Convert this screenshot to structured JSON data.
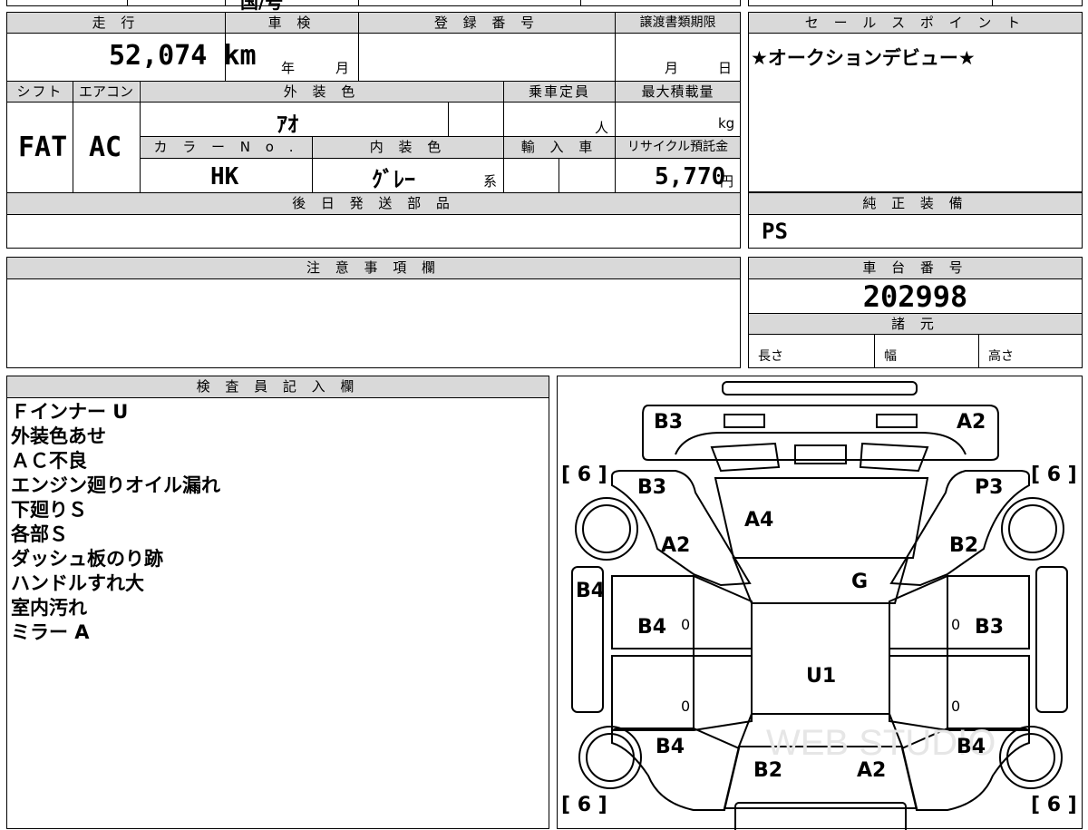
{
  "top_partial": {
    "fragment": "国/号"
  },
  "table": {
    "headers": {
      "mileage": "走 行",
      "inspection": "車 検",
      "registration": "登 録 番 号",
      "transfer_deadline": "譲渡書類期限",
      "shift": "シフト",
      "aircon": "エアコン",
      "exterior_color": "外 装 色",
      "capacity": "乗車定員",
      "max_load": "最大積載量",
      "color_no": "カ ラ ー N o .",
      "interior_color": "内 装 色",
      "import": "輸 入 車",
      "recycle_fee": "リサイクル預託金",
      "later_parts": "後 日 発 送 部 品"
    },
    "values": {
      "mileage": "52,074",
      "mileage_unit": "km",
      "year_unit": "年",
      "month_unit": "月",
      "month_unit2": "月",
      "day_unit": "日",
      "shift": "FAT",
      "aircon": "AC",
      "exterior_color": "ｱｵ",
      "capacity_unit": "人",
      "load_unit": "kg",
      "color_no": "HK",
      "interior_color": "ｸﾞﾚｰ",
      "interior_suffix": "系",
      "recycle_fee": "5,770",
      "recycle_unit": "円"
    }
  },
  "sales_point": {
    "header": "セ ー ル ス ポ イ ン ト",
    "text": "★オークションデビュー★"
  },
  "genuine_equipment": {
    "header": "純 正 装 備",
    "text": "PS"
  },
  "cautions": {
    "header": "注 意 事 項 欄"
  },
  "chassis": {
    "header": "車 台 番 号",
    "number": "202998"
  },
  "specs": {
    "header": "諸 元",
    "length": "長さ",
    "width": "幅",
    "height": "高さ"
  },
  "inspector_notes": {
    "header": "検 査 員 記 入 欄",
    "lines": [
      "Ｆインナー U",
      "外装色あせ",
      "ＡＣ不良",
      "エンジン廻りオイル漏れ",
      "下廻りＳ",
      "各部Ｓ",
      "ダッシュ板のり跡",
      "ハンドルすれ大",
      "室内汚れ",
      "ミラー A"
    ]
  },
  "diagram": {
    "labels": {
      "top_left": "B3",
      "top_right": "A2",
      "front_left_fender": "B3",
      "front_right_fender": "P3",
      "hood": "A4",
      "front_left_door_area": "A2",
      "front_right_door_area": "B2",
      "windshield": "G",
      "left_rocker": "B4",
      "left_front_door": "B4",
      "right_front_door": "B3",
      "roof": "U1",
      "rear_left_fender": "B4",
      "rear_right_fender": "B4",
      "trunk_left": "B2",
      "trunk_right": "A2",
      "tire_fl": "[ 6 ]",
      "tire_fr": "[ 6 ]",
      "tire_rl": "[ 6 ]",
      "tire_rr": "[ 6 ]",
      "zero": "0",
      "watermark": "WEB STUDIO"
    }
  }
}
